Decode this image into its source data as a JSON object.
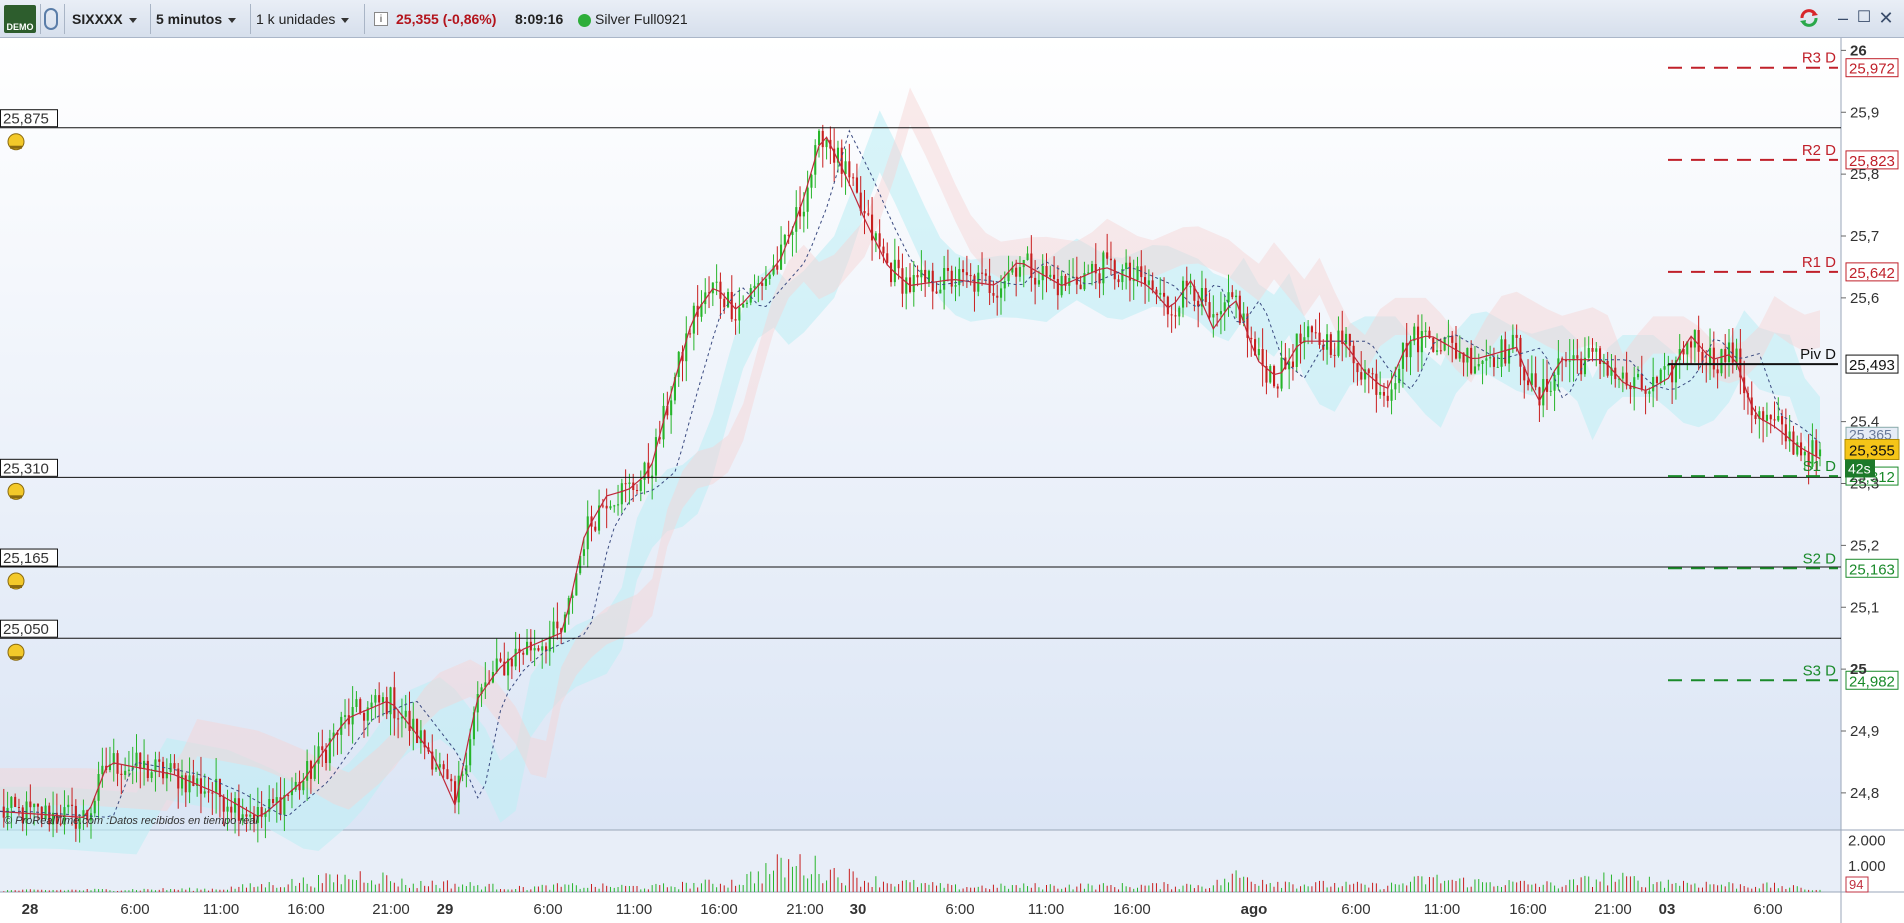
{
  "toolbar": {
    "demo_badge": "DEMO",
    "symbol": "SIXXXX",
    "timeframe": "5 minutos",
    "units": "1 k unidades",
    "price_change": "25,355 (-0,86%)",
    "time": "8:09:16",
    "account": "Silver Full0921",
    "info_glyph": "i",
    "minimize_glyph": "–",
    "maximize_glyph": "☐",
    "close_glyph": "✕",
    "icons": [
      "demo-logo",
      "link-icon",
      "info-icon",
      "refresh-icon"
    ]
  },
  "copyright": "© ProRealTime.com :Datos recibidos en tiempo real",
  "alert_labels": [
    "25,875",
    "25,310",
    "25,165",
    "25,050"
  ],
  "pivot_labels": [
    "R3 D",
    "R2 D",
    "R1 D",
    "Piv D",
    "S1 D",
    "S2 D",
    "S3 D"
  ],
  "pivot_values": [
    "25,972",
    "25,823",
    "25,642",
    "25,493",
    "25,312",
    "25,163",
    "24,982"
  ],
  "price_ticks": [
    "26",
    "25,9",
    "25,8",
    "25,7",
    "25,6",
    "25,4",
    "25,3",
    "25,2",
    "25,1",
    "25",
    "24,9",
    "24,8"
  ],
  "current_price": "25,355",
  "countdown": "42s",
  "hidden_price": "25,365",
  "volume_ticks": [
    "2.000",
    "1.000"
  ],
  "volume_last": "94",
  "time_labels": [
    "28",
    "6:00",
    "11:00",
    "16:00",
    "21:00",
    "29",
    "6:00",
    "11:00",
    "16:00",
    "21:00",
    "30",
    "6:00",
    "11:00",
    "16:00",
    "ago",
    "6:00",
    "11:00",
    "16:00",
    "21:00",
    "03",
    "6:00"
  ],
  "colors": {
    "bull": "#27b52a",
    "bear": "#c81e1e",
    "resistance": "#c0202a",
    "support": "#1a8a2a",
    "cloud_a": "#bfeff5",
    "cloud_b": "#f6d3d3",
    "current_badge": "#f5c518"
  },
  "chart_data": [
    {
      "type": "candlestick",
      "title": "",
      "x_labels": [
        "28",
        "6:00",
        "11:00",
        "16:00",
        "21:00",
        "29",
        "6:00",
        "11:00",
        "16:00",
        "21:00",
        "30",
        "6:00",
        "11:00",
        "16:00",
        "ago",
        "6:00",
        "11:00",
        "16:00",
        "21:00",
        "03",
        "6:00"
      ],
      "ylim": [
        24.74,
        26.02
      ],
      "y_ticks": [
        26.0,
        25.9,
        25.8,
        25.7,
        25.6,
        25.4,
        25.3,
        25.2,
        25.1,
        25.0,
        24.9,
        24.8
      ],
      "close_path": [
        [
          0,
          24.77
        ],
        [
          4,
          24.76
        ],
        [
          5,
          24.85
        ],
        [
          8,
          24.83
        ],
        [
          10,
          24.8
        ],
        [
          12,
          24.76
        ],
        [
          14,
          24.82
        ],
        [
          16,
          24.92
        ],
        [
          18,
          24.95
        ],
        [
          20,
          24.86
        ],
        [
          21,
          24.78
        ],
        [
          22,
          24.95
        ],
        [
          23,
          25.0
        ],
        [
          24,
          25.03
        ],
        [
          26,
          25.06
        ],
        [
          27,
          25.22
        ],
        [
          28,
          25.28
        ],
        [
          29,
          25.29
        ],
        [
          30,
          25.32
        ],
        [
          31,
          25.45
        ],
        [
          32,
          25.57
        ],
        [
          33,
          25.62
        ],
        [
          34,
          25.58
        ],
        [
          36,
          25.66
        ],
        [
          37,
          25.75
        ],
        [
          38,
          25.87
        ],
        [
          39,
          25.8
        ],
        [
          40,
          25.72
        ],
        [
          41,
          25.65
        ],
        [
          42,
          25.62
        ],
        [
          44,
          25.63
        ],
        [
          46,
          25.62
        ],
        [
          47,
          25.66
        ],
        [
          49,
          25.62
        ],
        [
          51,
          25.65
        ],
        [
          53,
          25.62
        ],
        [
          54,
          25.58
        ],
        [
          55,
          25.63
        ],
        [
          56,
          25.55
        ],
        [
          57,
          25.6
        ],
        [
          58,
          25.5
        ],
        [
          59,
          25.47
        ],
        [
          60,
          25.53
        ],
        [
          62,
          25.53
        ],
        [
          63,
          25.48
        ],
        [
          64,
          25.45
        ],
        [
          65,
          25.53
        ],
        [
          66,
          25.54
        ],
        [
          67,
          25.52
        ],
        [
          68,
          25.5
        ],
        [
          70,
          25.52
        ],
        [
          71,
          25.43
        ],
        [
          72,
          25.5
        ],
        [
          74,
          25.5
        ],
        [
          75,
          25.46
        ],
        [
          76,
          25.45
        ],
        [
          77,
          25.47
        ],
        [
          78,
          25.54
        ],
        [
          79,
          25.5
        ],
        [
          80,
          25.51
        ],
        [
          81,
          25.41
        ],
        [
          82,
          25.39
        ],
        [
          83,
          25.36
        ],
        [
          84,
          25.34
        ]
      ],
      "last_price": 25.355,
      "price_alerts": [
        25.875,
        25.31,
        25.165,
        25.05
      ],
      "pivots": {
        "R3 D": 25.972,
        "R2 D": 25.823,
        "R1 D": 25.642,
        "Piv D": 25.493,
        "S1 D": 25.312,
        "S2 D": 25.163,
        "S3 D": 24.982
      },
      "overlays": [
        "ichimoku-cloud",
        "moving-average"
      ]
    },
    {
      "type": "bar",
      "title": "",
      "ylim": [
        0,
        2400
      ],
      "y_ticks": [
        2000,
        1000
      ],
      "last_value": 94,
      "volume_profile": [
        [
          0,
          80
        ],
        [
          10,
          150
        ],
        [
          16,
          700
        ],
        [
          17,
          900
        ],
        [
          19,
          350
        ],
        [
          20,
          450
        ],
        [
          24,
          200
        ],
        [
          26,
          300
        ],
        [
          30,
          250
        ],
        [
          34,
          500
        ],
        [
          36,
          1300
        ],
        [
          37,
          1400
        ],
        [
          38,
          1100
        ],
        [
          40,
          600
        ],
        [
          44,
          250
        ],
        [
          48,
          300
        ],
        [
          52,
          300
        ],
        [
          56,
          350
        ],
        [
          57,
          800
        ],
        [
          58,
          650
        ],
        [
          60,
          400
        ],
        [
          64,
          300
        ],
        [
          66,
          650
        ],
        [
          68,
          500
        ],
        [
          72,
          350
        ],
        [
          74,
          700
        ],
        [
          76,
          550
        ],
        [
          78,
          450
        ],
        [
          80,
          350
        ],
        [
          82,
          300
        ],
        [
          84,
          100
        ]
      ]
    }
  ]
}
